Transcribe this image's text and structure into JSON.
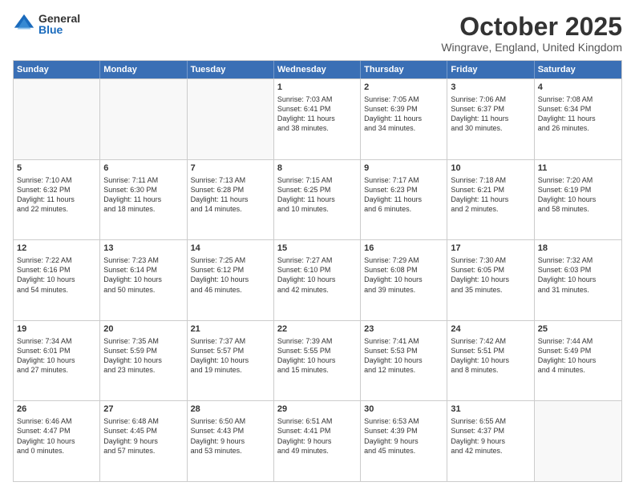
{
  "logo": {
    "general": "General",
    "blue": "Blue"
  },
  "header": {
    "month": "October 2025",
    "location": "Wingrave, England, United Kingdom"
  },
  "dayHeaders": [
    "Sunday",
    "Monday",
    "Tuesday",
    "Wednesday",
    "Thursday",
    "Friday",
    "Saturday"
  ],
  "weeks": [
    [
      {
        "day": "",
        "info": ""
      },
      {
        "day": "",
        "info": ""
      },
      {
        "day": "",
        "info": ""
      },
      {
        "day": "1",
        "info": "Sunrise: 7:03 AM\nSunset: 6:41 PM\nDaylight: 11 hours\nand 38 minutes."
      },
      {
        "day": "2",
        "info": "Sunrise: 7:05 AM\nSunset: 6:39 PM\nDaylight: 11 hours\nand 34 minutes."
      },
      {
        "day": "3",
        "info": "Sunrise: 7:06 AM\nSunset: 6:37 PM\nDaylight: 11 hours\nand 30 minutes."
      },
      {
        "day": "4",
        "info": "Sunrise: 7:08 AM\nSunset: 6:34 PM\nDaylight: 11 hours\nand 26 minutes."
      }
    ],
    [
      {
        "day": "5",
        "info": "Sunrise: 7:10 AM\nSunset: 6:32 PM\nDaylight: 11 hours\nand 22 minutes."
      },
      {
        "day": "6",
        "info": "Sunrise: 7:11 AM\nSunset: 6:30 PM\nDaylight: 11 hours\nand 18 minutes."
      },
      {
        "day": "7",
        "info": "Sunrise: 7:13 AM\nSunset: 6:28 PM\nDaylight: 11 hours\nand 14 minutes."
      },
      {
        "day": "8",
        "info": "Sunrise: 7:15 AM\nSunset: 6:25 PM\nDaylight: 11 hours\nand 10 minutes."
      },
      {
        "day": "9",
        "info": "Sunrise: 7:17 AM\nSunset: 6:23 PM\nDaylight: 11 hours\nand 6 minutes."
      },
      {
        "day": "10",
        "info": "Sunrise: 7:18 AM\nSunset: 6:21 PM\nDaylight: 11 hours\nand 2 minutes."
      },
      {
        "day": "11",
        "info": "Sunrise: 7:20 AM\nSunset: 6:19 PM\nDaylight: 10 hours\nand 58 minutes."
      }
    ],
    [
      {
        "day": "12",
        "info": "Sunrise: 7:22 AM\nSunset: 6:16 PM\nDaylight: 10 hours\nand 54 minutes."
      },
      {
        "day": "13",
        "info": "Sunrise: 7:23 AM\nSunset: 6:14 PM\nDaylight: 10 hours\nand 50 minutes."
      },
      {
        "day": "14",
        "info": "Sunrise: 7:25 AM\nSunset: 6:12 PM\nDaylight: 10 hours\nand 46 minutes."
      },
      {
        "day": "15",
        "info": "Sunrise: 7:27 AM\nSunset: 6:10 PM\nDaylight: 10 hours\nand 42 minutes."
      },
      {
        "day": "16",
        "info": "Sunrise: 7:29 AM\nSunset: 6:08 PM\nDaylight: 10 hours\nand 39 minutes."
      },
      {
        "day": "17",
        "info": "Sunrise: 7:30 AM\nSunset: 6:05 PM\nDaylight: 10 hours\nand 35 minutes."
      },
      {
        "day": "18",
        "info": "Sunrise: 7:32 AM\nSunset: 6:03 PM\nDaylight: 10 hours\nand 31 minutes."
      }
    ],
    [
      {
        "day": "19",
        "info": "Sunrise: 7:34 AM\nSunset: 6:01 PM\nDaylight: 10 hours\nand 27 minutes."
      },
      {
        "day": "20",
        "info": "Sunrise: 7:35 AM\nSunset: 5:59 PM\nDaylight: 10 hours\nand 23 minutes."
      },
      {
        "day": "21",
        "info": "Sunrise: 7:37 AM\nSunset: 5:57 PM\nDaylight: 10 hours\nand 19 minutes."
      },
      {
        "day": "22",
        "info": "Sunrise: 7:39 AM\nSunset: 5:55 PM\nDaylight: 10 hours\nand 15 minutes."
      },
      {
        "day": "23",
        "info": "Sunrise: 7:41 AM\nSunset: 5:53 PM\nDaylight: 10 hours\nand 12 minutes."
      },
      {
        "day": "24",
        "info": "Sunrise: 7:42 AM\nSunset: 5:51 PM\nDaylight: 10 hours\nand 8 minutes."
      },
      {
        "day": "25",
        "info": "Sunrise: 7:44 AM\nSunset: 5:49 PM\nDaylight: 10 hours\nand 4 minutes."
      }
    ],
    [
      {
        "day": "26",
        "info": "Sunrise: 6:46 AM\nSunset: 4:47 PM\nDaylight: 10 hours\nand 0 minutes."
      },
      {
        "day": "27",
        "info": "Sunrise: 6:48 AM\nSunset: 4:45 PM\nDaylight: 9 hours\nand 57 minutes."
      },
      {
        "day": "28",
        "info": "Sunrise: 6:50 AM\nSunset: 4:43 PM\nDaylight: 9 hours\nand 53 minutes."
      },
      {
        "day": "29",
        "info": "Sunrise: 6:51 AM\nSunset: 4:41 PM\nDaylight: 9 hours\nand 49 minutes."
      },
      {
        "day": "30",
        "info": "Sunrise: 6:53 AM\nSunset: 4:39 PM\nDaylight: 9 hours\nand 45 minutes."
      },
      {
        "day": "31",
        "info": "Sunrise: 6:55 AM\nSunset: 4:37 PM\nDaylight: 9 hours\nand 42 minutes."
      },
      {
        "day": "",
        "info": ""
      }
    ]
  ]
}
